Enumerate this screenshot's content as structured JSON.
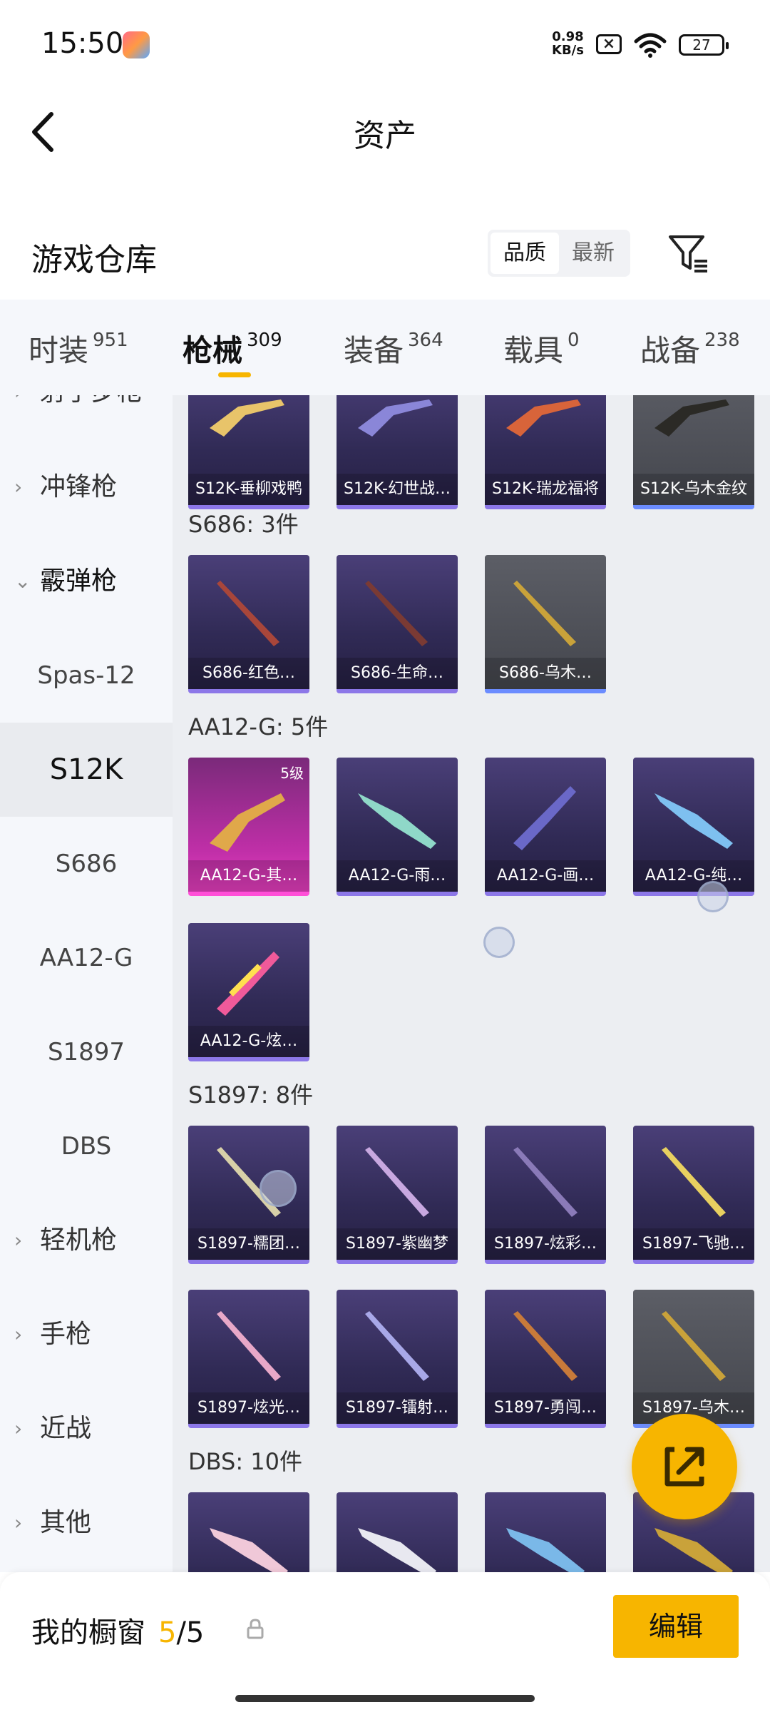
{
  "status_bar": {
    "time": "15:50",
    "net_speed_value": "0.98",
    "net_speed_unit": "KB/s",
    "battery": "27"
  },
  "nav": {
    "title": "资产"
  },
  "header": {
    "warehouse_title": "游戏仓库",
    "sort_quality": "品质",
    "sort_newest": "最新"
  },
  "tabs": [
    {
      "label": "时装",
      "count": "951"
    },
    {
      "label": "枪械",
      "count": "309"
    },
    {
      "label": "装备",
      "count": "364"
    },
    {
      "label": "载具",
      "count": "0"
    },
    {
      "label": "战备",
      "count": "238"
    }
  ],
  "sidebar": {
    "items": [
      {
        "label": "射手步枪"
      },
      {
        "label": "冲锋枪"
      },
      {
        "label": "霰弹枪"
      },
      {
        "label": "Spas-12"
      },
      {
        "label": "S12K"
      },
      {
        "label": "S686"
      },
      {
        "label": "AA12-G"
      },
      {
        "label": "S1897"
      },
      {
        "label": "DBS"
      },
      {
        "label": "轻机枪"
      },
      {
        "label": "手枪"
      },
      {
        "label": "近战"
      },
      {
        "label": "其他"
      }
    ]
  },
  "content": {
    "s12k_cards": [
      "S12K-垂柳戏鸭",
      "S12K-幻世战…",
      "S12K-瑞龙福将",
      "S12K-乌木金纹"
    ],
    "s686_header": "S686: 3件",
    "s686_cards": [
      "S686-红色…",
      "S686-生命…",
      "S686-乌木…"
    ],
    "aa12_header": "AA12-G: 5件",
    "aa12_cards": [
      "AA12-G-其…",
      "AA12-G-雨…",
      "AA12-G-画…",
      "AA12-G-纯…",
      "AA12-G-炫…"
    ],
    "aa12_level_badge": "5级",
    "s1897_header": "S1897: 8件",
    "s1897_cards": [
      "S1897-糯团…",
      "S1897-紫幽梦",
      "S1897-炫彩…",
      "S1897-飞驰…",
      "S1897-炫光…",
      "S1897-镭射…",
      "S1897-勇闯…",
      "S1897-乌木…"
    ],
    "dbs_header": "DBS: 10件"
  },
  "bottom_bar": {
    "showcase_label": "我的橱窗",
    "showcase_used": "5",
    "showcase_total": "/5",
    "edit_label": "编辑"
  },
  "colors": {
    "accent": "#f7b500",
    "card_purple": "#302a55",
    "card_gray": "#4a4c53",
    "card_pink": "#c02fa8"
  },
  "icons": {
    "back": "chevron-left-icon",
    "filter": "filter-icon",
    "lock": "lock-icon",
    "share": "share-icon",
    "wifi": "wifi-icon"
  }
}
